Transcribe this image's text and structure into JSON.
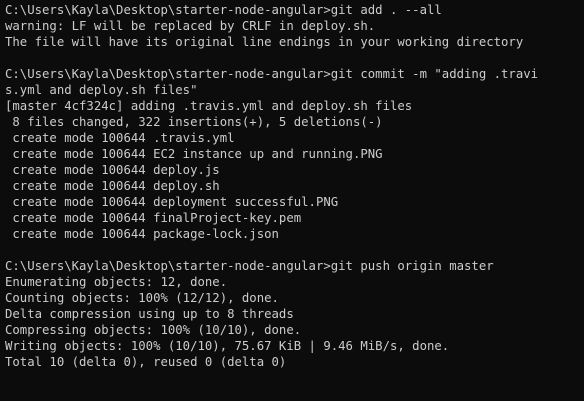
{
  "terminal": {
    "lines": [
      "C:\\Users\\Kayla\\Desktop\\starter-node-angular>git add . --all",
      "warning: LF will be replaced by CRLF in deploy.sh.",
      "The file will have its original line endings in your working directory",
      "",
      "C:\\Users\\Kayla\\Desktop\\starter-node-angular>git commit -m \"adding .travi",
      "s.yml and deploy.sh files\"",
      "[master 4cf324c] adding .travis.yml and deploy.sh files",
      " 8 files changed, 322 insertions(+), 5 deletions(-)",
      " create mode 100644 .travis.yml",
      " create mode 100644 EC2 instance up and running.PNG",
      " create mode 100644 deploy.js",
      " create mode 100644 deploy.sh",
      " create mode 100644 deployment successful.PNG",
      " create mode 100644 finalProject-key.pem",
      " create mode 100644 package-lock.json",
      "",
      "C:\\Users\\Kayla\\Desktop\\starter-node-angular>git push origin master",
      "Enumerating objects: 12, done.",
      "Counting objects: 100% (12/12), done.",
      "Delta compression using up to 8 threads",
      "Compressing objects: 100% (10/10), done.",
      "Writing objects: 100% (10/10), 75.67 KiB | 9.46 MiB/s, done.",
      "Total 10 (delta 0), reused 0 (delta 0)"
    ]
  }
}
